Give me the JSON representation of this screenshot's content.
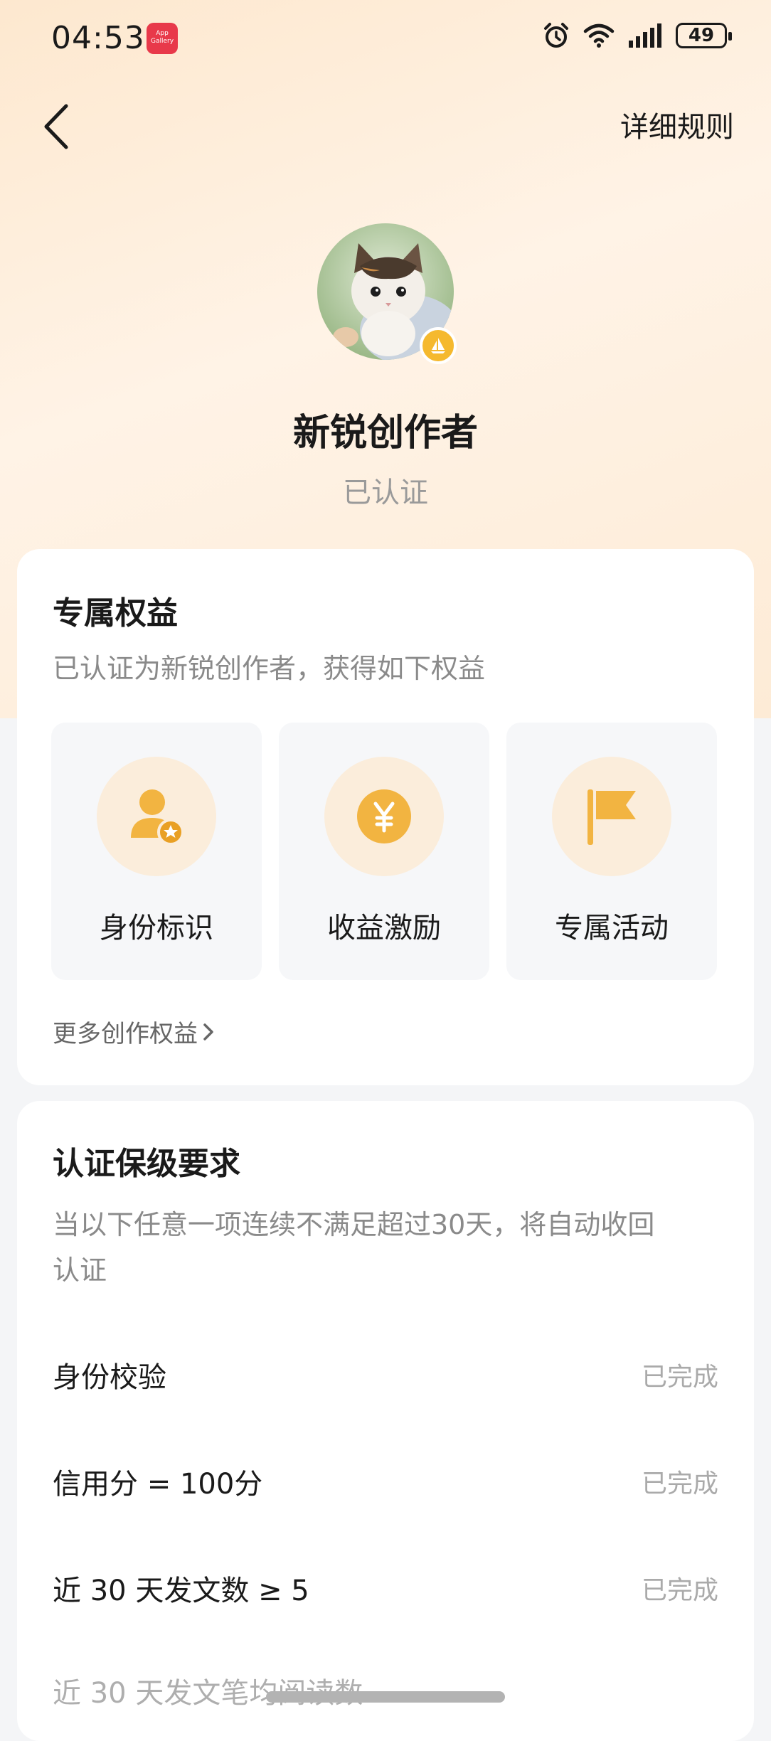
{
  "status_bar": {
    "time": "04:53",
    "app_badge_text": "App Gallery",
    "battery": "49",
    "icons": [
      "alarm-icon",
      "wifi-icon",
      "signal-icon",
      "battery-icon"
    ]
  },
  "header": {
    "back_icon": "chevron-left-icon",
    "rules_label": "详细规则"
  },
  "profile": {
    "title": "新锐创作者",
    "status": "已认证",
    "avatar": "kitten-photo",
    "badge_icon": "sailboat-icon"
  },
  "benefits": {
    "title": "专属权益",
    "desc": "已认证为新锐创作者，获得如下权益",
    "items": [
      {
        "label": "身份标识",
        "icon": "user-star-icon"
      },
      {
        "label": "收益激励",
        "icon": "yuan-coin-icon"
      },
      {
        "label": "专属活动",
        "icon": "flag-icon"
      }
    ],
    "more_label": "更多创作权益"
  },
  "requirements": {
    "title": "认证保级要求",
    "desc_line1": "当以下任意一项连续不满足超过30天，将自动收回",
    "desc_line2": "认证",
    "items": [
      {
        "label": "身份校验",
        "status": "已完成"
      },
      {
        "label": "信用分 = 100分",
        "status": "已完成"
      },
      {
        "label": "近 30 天发文数 ≥ 5",
        "status": "已完成"
      }
    ],
    "partial_label": "近 30 天发文笔均阅读数"
  },
  "colors": {
    "accent": "#f5b92e",
    "icon_bg": "#fbeddb",
    "muted": "#aaaaaa"
  }
}
